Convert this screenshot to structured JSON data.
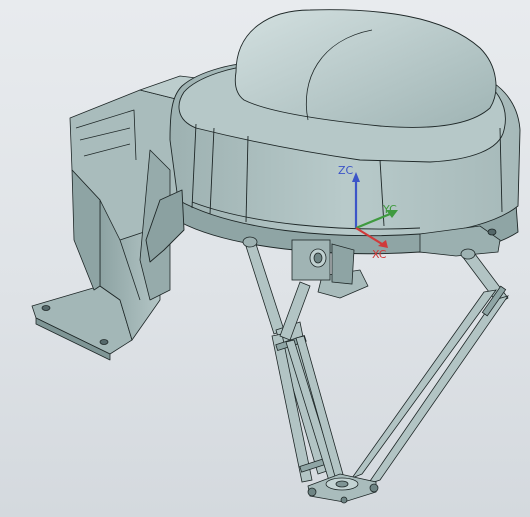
{
  "viewport": {
    "axis_triad": {
      "z_label": "ZC",
      "y_label": "YC",
      "x_label": "XC"
    },
    "colors": {
      "background_top": "#e8ebee",
      "background_bottom": "#d4d9de",
      "model_fill": "#aabdbd",
      "model_light": "#c2d3d3",
      "model_dark": "#7f9696",
      "edge": "#1e2727",
      "z_axis": "#3c55c8",
      "y_axis": "#3f9a3f",
      "x_axis": "#d03a3a"
    }
  }
}
